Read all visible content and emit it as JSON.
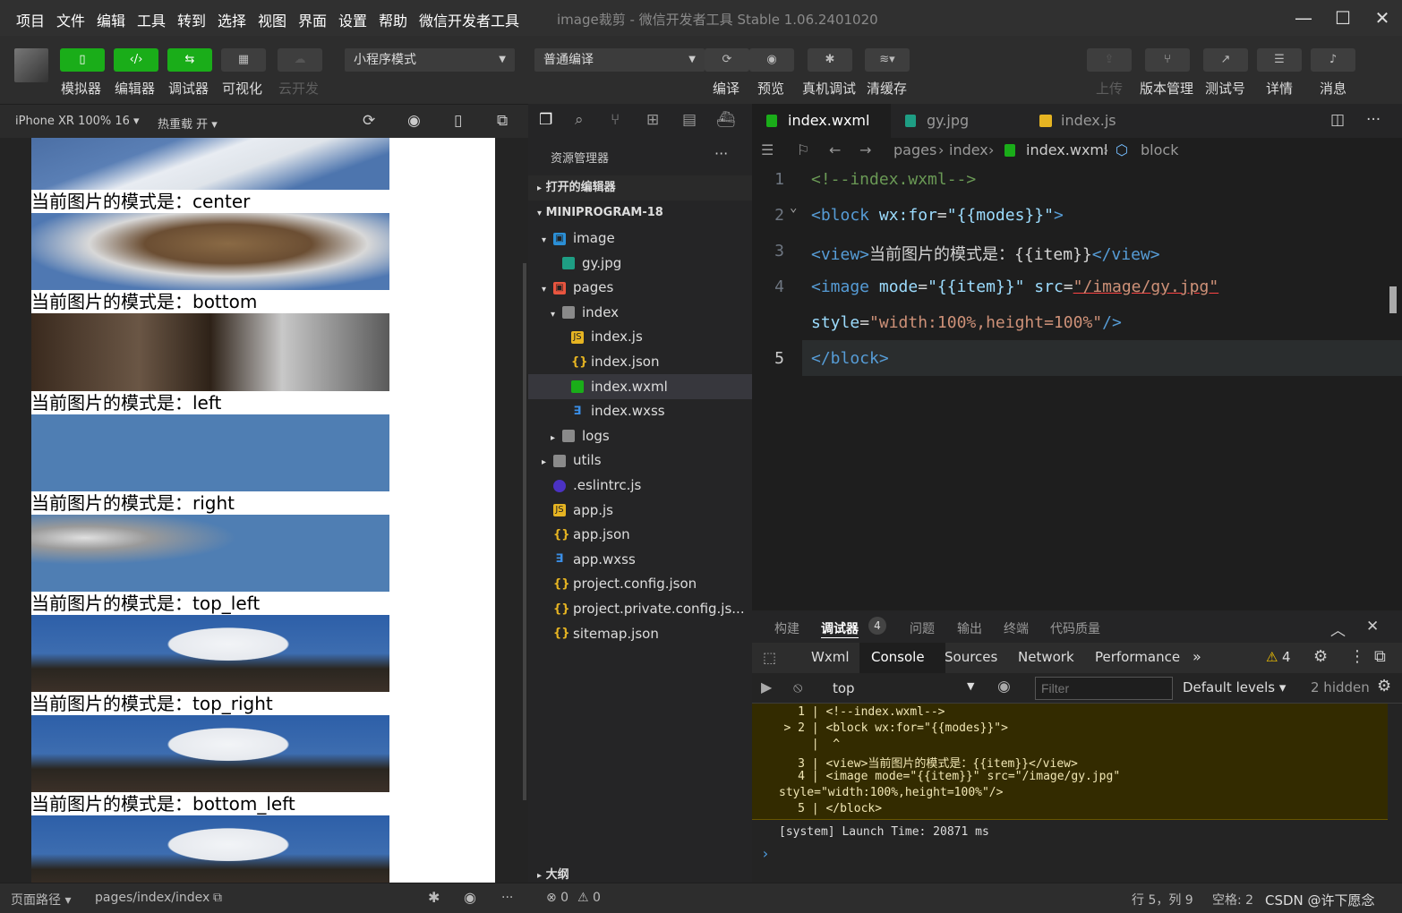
{
  "menu": [
    "项目",
    "文件",
    "编辑",
    "工具",
    "转到",
    "选择",
    "视图",
    "界面",
    "设置",
    "帮助",
    "微信开发者工具"
  ],
  "window_title": "image裁剪 - 微信开发者工具 Stable 1.06.2401020",
  "toolbar": {
    "simulator": "模拟器",
    "editor": "编辑器",
    "debugger": "调试器",
    "visual": "可视化",
    "cloud": "云开发",
    "mode": "小程序模式",
    "compile_mode": "普通编译",
    "compile": "编译",
    "preview": "预览",
    "device_debug": "真机调试",
    "clear_cache": "清缓存",
    "upload": "上传",
    "version": "版本管理",
    "test_id": "测试号",
    "details": "详情",
    "messages": "消息"
  },
  "simbar": {
    "device": "iPhone XR 100% 16 ▾",
    "hot_reload": "热重载 开 ▾"
  },
  "simulator": {
    "caption_prefix": "当前图片的模式是：",
    "modes": [
      "center",
      "bottom",
      "left",
      "right",
      "top_left",
      "top_right",
      "bottom_left"
    ]
  },
  "explorer": {
    "title": "资源管理器",
    "more": "···",
    "open_editors": "打开的编辑器",
    "project": "MINIPROGRAM-18",
    "outline": "大纲",
    "tree": [
      {
        "name": "image",
        "depth": 1,
        "arrow": "▾",
        "icon": "folder-img"
      },
      {
        "name": "gy.jpg",
        "depth": 2,
        "arrow": "",
        "icon": "image"
      },
      {
        "name": "pages",
        "depth": 1,
        "arrow": "▾",
        "icon": "folder-pages"
      },
      {
        "name": "index",
        "depth": 2,
        "arrow": "▾",
        "icon": "folder"
      },
      {
        "name": "index.js",
        "depth": 3,
        "arrow": "",
        "icon": "js"
      },
      {
        "name": "index.json",
        "depth": 3,
        "arrow": "",
        "icon": "json"
      },
      {
        "name": "index.wxml",
        "depth": 3,
        "arrow": "",
        "icon": "wxml",
        "selected": true
      },
      {
        "name": "index.wxss",
        "depth": 3,
        "arrow": "",
        "icon": "wxss"
      },
      {
        "name": "logs",
        "depth": 2,
        "arrow": "▸",
        "icon": "folder"
      },
      {
        "name": "utils",
        "depth": 1,
        "arrow": "▸",
        "icon": "folder"
      },
      {
        "name": ".eslintrc.js",
        "depth": 1,
        "arrow": "",
        "icon": "eslint"
      },
      {
        "name": "app.js",
        "depth": 1,
        "arrow": "",
        "icon": "js"
      },
      {
        "name": "app.json",
        "depth": 1,
        "arrow": "",
        "icon": "json"
      },
      {
        "name": "app.wxss",
        "depth": 1,
        "arrow": "",
        "icon": "wxss"
      },
      {
        "name": "project.config.json",
        "depth": 1,
        "arrow": "",
        "icon": "json"
      },
      {
        "name": "project.private.config.js...",
        "depth": 1,
        "arrow": "",
        "icon": "json"
      },
      {
        "name": "sitemap.json",
        "depth": 1,
        "arrow": "",
        "icon": "json"
      }
    ]
  },
  "tabs": [
    {
      "label": "index.wxml",
      "active": true,
      "close": "✕"
    },
    {
      "label": "gy.jpg"
    },
    {
      "label": "index.js"
    }
  ],
  "breadcrumb": {
    "a": "pages",
    "b": "index",
    "c": "index.wxml",
    "d": "block"
  },
  "code": {
    "l1": "<!--index.wxml-->",
    "l2a": "<block ",
    "l2b": "wx:for",
    "l2c": "=",
    "l2d": "\"{{modes}}\"",
    "l2e": ">",
    "l3a": "<view>",
    "l3b": "当前图片的模式是：{{item}}",
    "l3c": "</view>",
    "l4a": "<image ",
    "l4b": "mode",
    "l4c": "=",
    "l4d": "\"{{item}}\"",
    "l4e": " src",
    "l4f": "=",
    "l4g": "\"/image/gy.jpg\"",
    "l4h": "style",
    "l4i": "=",
    "l4j": "\"width:100%,height=100%\"",
    "l4k": "/>",
    "l5": "</block>",
    "n1": "1",
    "n2": "2",
    "n3": "3",
    "n4": "4",
    "n5": "5"
  },
  "devtools": {
    "build": "构建",
    "debugger": "调试器",
    "badge": "4",
    "problems": "问题",
    "output": "输出",
    "terminal": "终端",
    "quality": "代码质量",
    "wxml": "Wxml",
    "console": "Console",
    "sources": "Sources",
    "network": "Network",
    "performance": "Performance",
    "more": "»",
    "warn_count": "4",
    "context": "top",
    "filter_placeholder": "Filter",
    "levels": "Default levels ▾",
    "hidden": "2 hidden"
  },
  "console_lines": {
    "e1": "     1 | <!--index.wxml-->",
    "e2": "   > 2 | <block wx:for=\"{{modes}}\">",
    "e3": "       |  ^",
    "e4": "     3 | <view>当前图片的模式是：{{item}}</view>",
    "e5": "     4 | <image mode=\"{{item}}\" src=\"/image/gy.jpg\"",
    "e6": "style=\"width:100%,height=100%\"/>",
    "e7": "     5 | </block>",
    "sys": "[system] Launch Time: 20871 ms",
    "prompt": "›"
  },
  "status": {
    "path_label": "页面路径 ▾",
    "path": "pages/index/index",
    "errors": "⊗ 0",
    "warnings": "⚠ 0",
    "position": "行 5，列 9",
    "spaces": "空格: 2",
    "watermark": "CSDN @许下愿念"
  },
  "colors": {
    "accent": "#1aad19",
    "bg": "#2d2d2d",
    "editor": "#1e1e1e"
  }
}
